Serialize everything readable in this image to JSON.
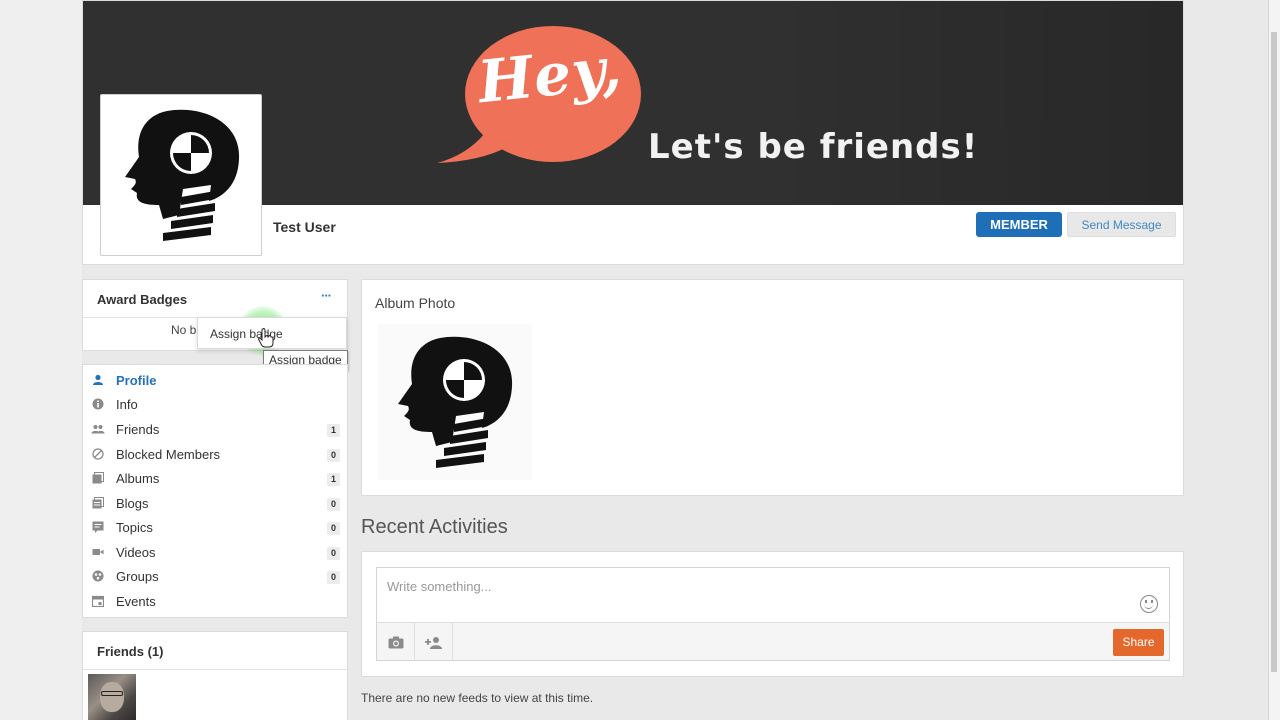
{
  "cover": {
    "greeting": "Hey,",
    "tagline": "Let's be friends!",
    "bubble_color": "#ef7158"
  },
  "profile": {
    "name": "Test User",
    "member_label": "MEMBER",
    "send_message_label": "Send Message",
    "accent": "#1f6fb8"
  },
  "award_badges": {
    "title": "Award Badges",
    "more_icon": "ellipsis-icon",
    "more_label": "···",
    "empty_text": "No ba",
    "menu_item": "Assign badge",
    "tooltip": "Assign badge"
  },
  "nav": {
    "items": [
      {
        "label": "Profile",
        "icon": "person-icon",
        "glyph": "👤",
        "count": ""
      },
      {
        "label": "Info",
        "icon": "info-icon",
        "glyph": "ℹ",
        "count": ""
      },
      {
        "label": "Friends",
        "icon": "friends-icon",
        "glyph": "👥",
        "count": "1"
      },
      {
        "label": "Blocked Members",
        "icon": "blocked-icon",
        "glyph": "⊘",
        "count": "0"
      },
      {
        "label": "Albums",
        "icon": "albums-icon",
        "glyph": "▤",
        "count": "1"
      },
      {
        "label": "Blogs",
        "icon": "blogs-icon",
        "glyph": "▤",
        "count": "0"
      },
      {
        "label": "Topics",
        "icon": "topics-icon",
        "glyph": "▣",
        "count": "0"
      },
      {
        "label": "Videos",
        "icon": "video-icon",
        "glyph": "■",
        "count": "0"
      },
      {
        "label": "Groups",
        "icon": "groups-icon",
        "glyph": "◉",
        "count": "0"
      },
      {
        "label": "Events",
        "icon": "calendar-icon",
        "glyph": "▦",
        "count": ""
      }
    ]
  },
  "friends_panel": {
    "title": "Friends (1)"
  },
  "album": {
    "title": "Album Photo"
  },
  "activities": {
    "title": "Recent Activities",
    "placeholder": "Write something...",
    "share_label": "Share",
    "camera_icon": "camera-icon",
    "tag_icon": "add-person-icon",
    "emoji_icon": "smiley-icon",
    "empty_text": "There are no new feeds to view at this time."
  }
}
